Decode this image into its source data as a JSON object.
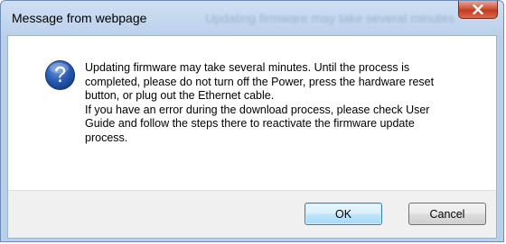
{
  "window": {
    "title": "Message from webpage",
    "ghost_title": "Updating firmware may take several minutes"
  },
  "dialog": {
    "icon": "question-icon",
    "message_lines": [
      "Updating firmware may take several minutes. Until the process is",
      "completed, please do not turn off the Power, press the hardware reset",
      "button, or plug out the Ethernet cable.",
      "If you have an error during the download process, please check User",
      "Guide and follow the steps there to reactivate the firmware update",
      "process."
    ]
  },
  "buttons": {
    "ok_label": "OK",
    "cancel_label": "Cancel"
  },
  "colors": {
    "frame": "#b9d0eb",
    "close_button": "#c23b22",
    "icon_blue": "#1f4f9a",
    "ok_highlight": "#3c7fb1"
  }
}
